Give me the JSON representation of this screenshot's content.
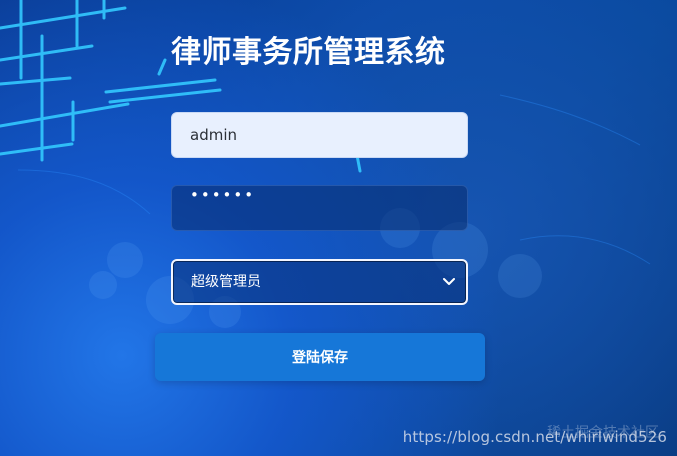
{
  "app": {
    "title": "律师事务所管理系统"
  },
  "login": {
    "username_value": "admin",
    "password_value": "••••••",
    "role_selected": "超级管理员",
    "submit_label": "登陆保存"
  },
  "footer": {
    "watermark_url": "https://blog.csdn.net/whirlwind526",
    "ghost_watermark": "稀土掘金技术社区"
  },
  "theme": {
    "background_primary": "#0b4aa8",
    "button_color": "#1677d8",
    "line_color": "#33c9ff"
  },
  "icons": {
    "dropdown": "chevron-down-icon"
  }
}
